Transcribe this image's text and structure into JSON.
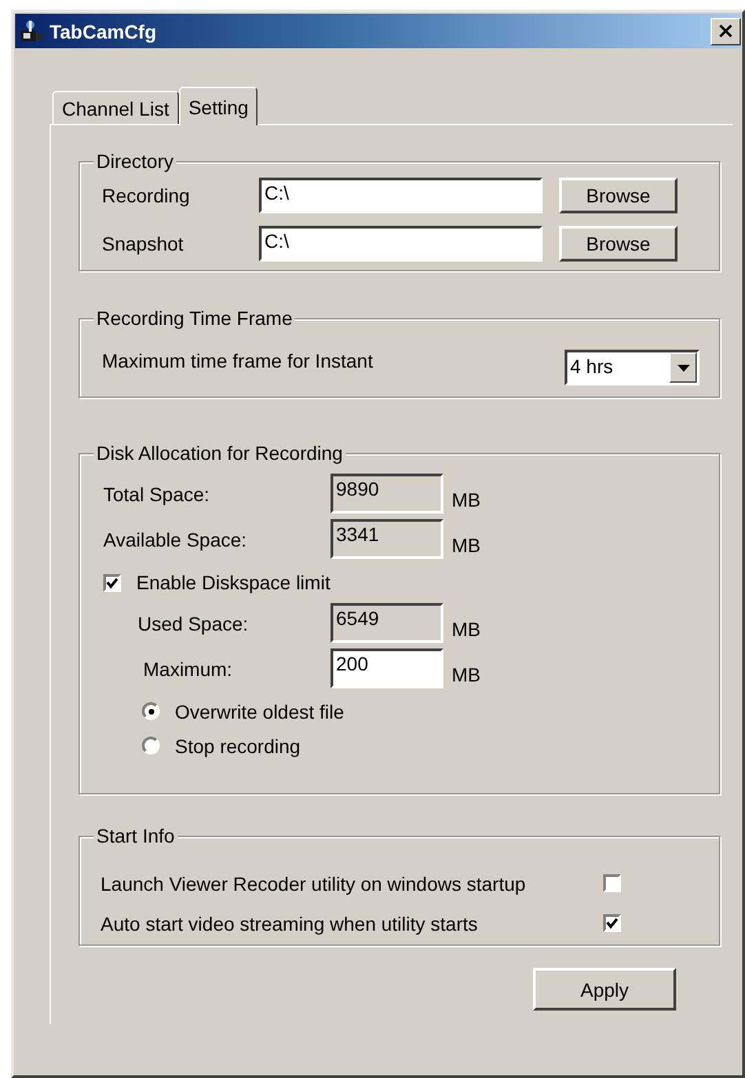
{
  "window": {
    "title": "TabCamCfg"
  },
  "tabs": [
    {
      "label": "Channel List",
      "selected": false
    },
    {
      "label": "Setting",
      "selected": true
    }
  ],
  "directory": {
    "title": "Directory",
    "rows": [
      {
        "label": "Recording",
        "value": "C:\\",
        "button": "Browse"
      },
      {
        "label": "Snapshot",
        "value": "C:\\",
        "button": "Browse"
      }
    ]
  },
  "time_frame": {
    "title": "Recording Time Frame",
    "label": "Maximum time frame for Instant",
    "value": "4 hrs"
  },
  "disk": {
    "title": "Disk Allocation for Recording",
    "fields": [
      {
        "label": "Total Space:",
        "value": "9890",
        "unit": "MB",
        "readonly": true
      },
      {
        "label": "Available Space:",
        "value": "3341",
        "unit": "MB",
        "readonly": true
      }
    ],
    "limit": {
      "label": "Enable Diskspace limit",
      "checked": true
    },
    "limit_fields": [
      {
        "label": "Used Space:",
        "value": "6549",
        "unit": "MB",
        "readonly": true
      },
      {
        "label": "Maximum:",
        "value": "200",
        "unit": "MB",
        "readonly": false
      }
    ],
    "options": [
      {
        "label": "Overwrite oldest file",
        "selected": true
      },
      {
        "label": "Stop recording",
        "selected": false
      }
    ]
  },
  "start_info": {
    "title": "Start Info",
    "options": [
      {
        "label": "Launch Viewer Recoder utility on windows startup",
        "checked": false
      },
      {
        "label": "Auto start video streaming when utility starts",
        "checked": true
      }
    ]
  },
  "apply": "Apply"
}
